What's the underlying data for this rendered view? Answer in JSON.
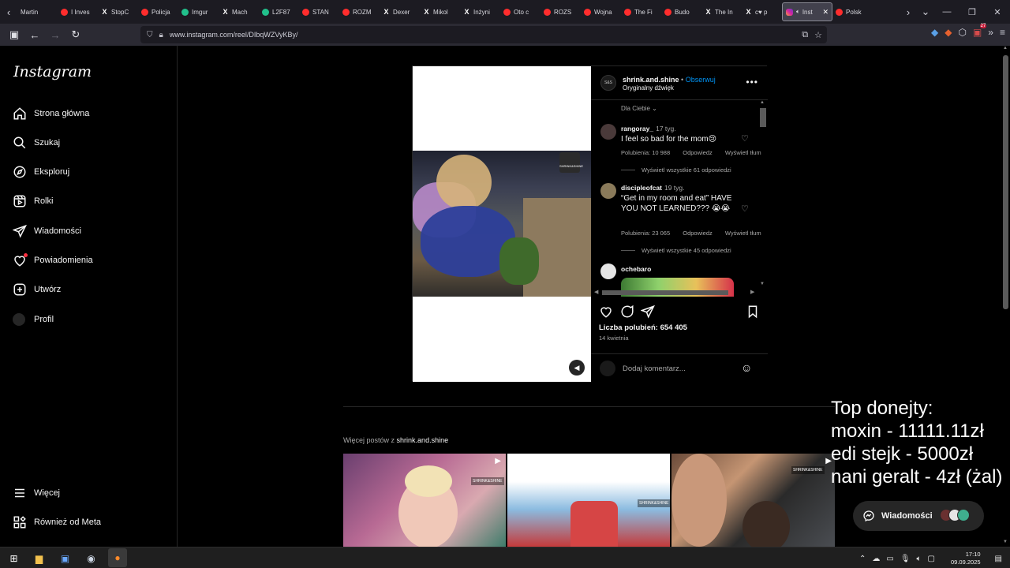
{
  "browser": {
    "tabs": [
      {
        "label": "Martin",
        "icon": "chevron-left-icon",
        "fav": "none"
      },
      {
        "label": "I Inves",
        "fav": "yt"
      },
      {
        "label": "StopC",
        "fav": "x"
      },
      {
        "label": "Policja",
        "fav": "yt"
      },
      {
        "label": "Imgur",
        "fav": "green"
      },
      {
        "label": "Mach",
        "fav": "x"
      },
      {
        "label": "L2F87",
        "fav": "green"
      },
      {
        "label": "STAN",
        "fav": "yt"
      },
      {
        "label": "ROZM",
        "fav": "yt"
      },
      {
        "label": "Dexer",
        "fav": "x"
      },
      {
        "label": "Mikol",
        "fav": "x"
      },
      {
        "label": "Inżyni",
        "fav": "x"
      },
      {
        "label": "Oto c",
        "fav": "yt"
      },
      {
        "label": "ROZS",
        "fav": "yt"
      },
      {
        "label": "Wojna",
        "fav": "yt"
      },
      {
        "label": "The Fi",
        "fav": "yt"
      },
      {
        "label": "Budo",
        "fav": "yt"
      },
      {
        "label": "The In",
        "fav": "x"
      },
      {
        "label": "c♥ p",
        "fav": "x"
      }
    ],
    "active_tab": {
      "label": "Inst",
      "close": "✕"
    },
    "tabs_after": [
      {
        "label": "Polsk",
        "fav": "yt"
      }
    ],
    "url": "www.instagram.com/reel/DIbqWZVyKBy/"
  },
  "sidebar": {
    "logo": "Instagram",
    "items": [
      {
        "label": "Strona główna",
        "icon": "home-icon"
      },
      {
        "label": "Szukaj",
        "icon": "search-icon"
      },
      {
        "label": "Eksploruj",
        "icon": "compass-icon"
      },
      {
        "label": "Rolki",
        "icon": "reels-icon"
      },
      {
        "label": "Wiadomości",
        "icon": "send-icon"
      },
      {
        "label": "Powiadomienia",
        "icon": "heart-icon"
      },
      {
        "label": "Utwórz",
        "icon": "plus-square-icon"
      },
      {
        "label": "Profil",
        "icon": "avatar-icon"
      }
    ],
    "bottom_items": [
      {
        "label": "Więcej",
        "icon": "menu-icon"
      },
      {
        "label": "Również od Meta",
        "icon": "meta-grid-icon"
      }
    ]
  },
  "post": {
    "username": "shrink.and.shine",
    "separator": "•",
    "follow_label": "Obserwuj",
    "audio": "Oryginalny dźwięk",
    "sort_label": "Dla Ciebie",
    "watermark": "SHRINK&SHINE",
    "comments": [
      {
        "user": "rangoray_",
        "time": "17 tyg.",
        "text": "I feel so bad for the mom😢",
        "likes": "Polubienia: 10 988",
        "reply": "Odpowiedz",
        "translate": "Wyświetl tłum",
        "replies": "Wyświetl wszystkie 61 odpowiedzi",
        "avatar_color": "#4a3a3a"
      },
      {
        "user": "discipleofcat",
        "time": "19 tyg.",
        "text": "“Get in my room and eat” HAVE YOU NOT LEARNED??? 😭😭",
        "likes": "Polubienia: 23 065",
        "reply": "Odpowiedz",
        "translate": "Wyświetl tłum",
        "replies": "Wyświetl wszystkie 45 odpowiedzi",
        "avatar_color": "#8a7a5a"
      },
      {
        "user": "ochebaro",
        "avatar_color": "#e6e6e6"
      }
    ],
    "likes_total": "Liczba polubień: 654 405",
    "date": "14 kwietnia",
    "add_comment_placeholder": "Dodaj komentarz..."
  },
  "more_posts": {
    "prefix": "Więcej postów z",
    "user": "shrink.and.shine"
  },
  "overlay": {
    "lines": [
      "Top donejty:",
      "moxin - 11111.11zł",
      "edi stejk - 5000zł",
      "nani geralt - 4zł (żal)"
    ]
  },
  "messages_pill": {
    "label": "Wiadomości"
  },
  "taskbar": {
    "time": "17:10",
    "date": "09.09.2025"
  },
  "colors": {
    "accent_blue": "#0095f6",
    "notification_red": "#ff3040",
    "background": "#000000"
  }
}
